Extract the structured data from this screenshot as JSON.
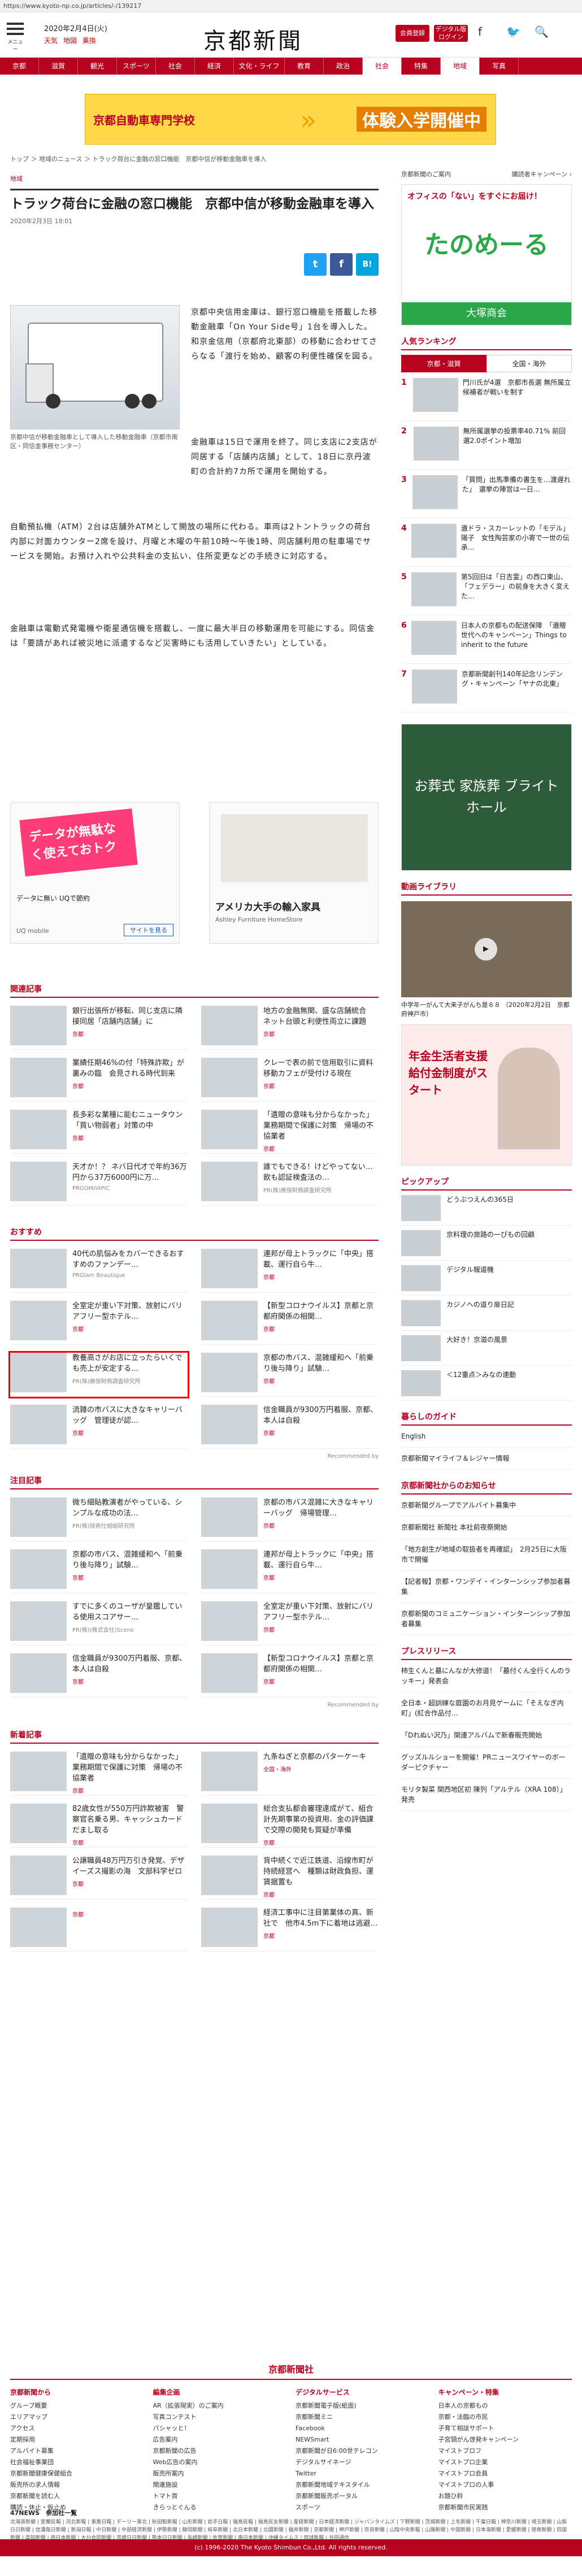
{
  "url": "https://www.kyoto-np.co.jp/articles/-/139217",
  "header": {
    "menu_label": "メニュー",
    "date": "2020年2月4日(火)",
    "weather": [
      "天気",
      "地図",
      "乗換"
    ],
    "logo": "京都新聞",
    "members_label": "会員登録",
    "digital_label": "デジタル版ログイン",
    "facebook_label": "Facebook",
    "twitter_label": "Twitter",
    "menu2_label": "メニュー"
  },
  "nav": [
    "京都",
    "滋賀",
    "観光",
    "スポーツ",
    "社会",
    "経済",
    "文化・ライフ",
    "教育",
    "政治",
    "社会",
    "特集",
    "地域",
    "写真"
  ],
  "top_banner": {
    "left": "京都自動車専門学校",
    "right": "体験入学開催中"
  },
  "breadcrumb": "トップ ＞ 地域のニュース ＞ トラック荷台に金融の窓口機能　京都中信が移動金融車を導入",
  "article": {
    "category": "地域",
    "title": "トラック荷台に金融の窓口機能　京都中信が移動金融車を導入",
    "date": "2020年2月3日 18:01",
    "share": [
      "t",
      "f",
      "B!"
    ],
    "photo_caption": "京都中信が移動金融車として導入した移動金融車（京都市南区・同信金事務センター）",
    "para1": "京都中央信用金庫は、銀行窓口機能を搭載した移動金融車「On Your Side号」1台を導入した。和京金信用（京都府北東部）の移動に合わせてさらなる「渡行を始め、顧客の利便性確保を図る。",
    "para2": "金融車は15日で運用を終了。同じ支店に2支店が同居する「店舗内店舗」として、18日に京丹波町の合計約7カ所で運用を開始する。",
    "para3": "自動預払機（ATM）2台は店舗外ATMとして開放の場所に代わる。車両は2トントラックの荷台内部に対面カウンター2席を設け、月曜と木曜の午前10時～午後1時、同店舗利用の駐車場でサービスを開始。お預け入れや公共料金の支払い、住所変更などの手続きに対応する。",
    "para4": "金融車は電動式発電機や衛星通信機を搭載し、一度に最大半日の移動運用を可能にする。同信金は「要請があれば被災地に派遣するなど災害時にも活用していきたい」としている。"
  },
  "ads": {
    "left_headline": "データが無駄なく使えておトク",
    "left_brand": "UQ mobile",
    "left_sub": "データに無い UQで節約",
    "left_link": "サイトを見る",
    "right_headline": "アメリカ大手の輸入家具",
    "right_brand": "Ashley Furniture HomeStore"
  },
  "related": {
    "title": "関連記事",
    "items": [
      {
        "text": "銀行出張所が移転、同じ支店に隣接同居「店舗内店舗」に",
        "tag": "京都"
      },
      {
        "text": "地方の金融無関、盛な店舗統合　ネット台頭と利便性両立に課題",
        "tag": "京都"
      },
      {
        "text": "業績任期46%の付「特殊詐欺」が裏みの臨　会見される時代到来",
        "tag": "京都"
      },
      {
        "text": "クレーで表の前で信用取引に資料　移動カフェが受付ける現在",
        "tag": "京都"
      },
      {
        "text": "長多彩な業種に能むニュータウン「買い物弱者」対策の中",
        "tag": "京都"
      },
      {
        "text": "「遺贈の意味も分からなかった」業務期間で保護に対策　帰場の不協業者",
        "tag": "京都"
      },
      {
        "text": "天才か！？ ネバ日代才で年約36万円から37万6000円に万…",
        "src": "PRGOM/IAPIC"
      },
      {
        "text": "誰でもできる！けどやってない…飲も認証検査法の…",
        "src": "PR(株)勝俣財務調査研究所"
      }
    ]
  },
  "recommended": {
    "title": "おすすめ",
    "items": [
      {
        "text": "40代の肌悩みをカバーできるおすすめのファンデー…",
        "src": "PRGlam Beautique"
      },
      {
        "text": "連邦が母上トラックに「中央」搭載、運行自ら牛…",
        "tag": "京都"
      },
      {
        "text": "全室定が重い下対策、放射にバリアフリー型ホテル…",
        "tag": "京都"
      },
      {
        "text": "【新型コロナウイルス】京都と京都府関係の相関…",
        "tag": "京都"
      },
      {
        "text": "教養高さがお店に立ったらいくでも売上が安定する…",
        "src": "PR(株)勝俣財務調査研究所"
      },
      {
        "text": "京都の市バス、混雑緩和へ「前乗り後与降り」試験…",
        "tag": "京都"
      },
      {
        "text": "流雑の市バスに大きなキャリーバッグ　管理徒が認…",
        "tag": "京都"
      },
      {
        "text": "信金職員が9300万円着服、京都、本人は自殺",
        "tag": "京都"
      }
    ],
    "footer": "Recommended by"
  },
  "noted": {
    "title": "注目記事",
    "items": [
      {
        "text": "微ち細貼教演者がやっている、シンプルな成功の法…",
        "src": "PR(株)技術仕組組研究所"
      },
      {
        "text": "京都の市バス混雑に大きなキャリーバッグ　帰場管理…",
        "tag": "京都"
      },
      {
        "text": "京都の市バス、混雑緩和へ「前乗り後与降り」試験…",
        "tag": "京都"
      },
      {
        "text": "連邦が母上トラックに「中央」搭載、運行自ら牛…",
        "tag": "京都"
      },
      {
        "text": "すでに多くのユーザが皇鑑している使用スコアサー…",
        "src": "PR(株)(株式会社)Scene"
      },
      {
        "text": "全室定が重い下対策、放射にバリアフリー型ホテル…",
        "tag": "京都"
      },
      {
        "text": "信金職員が9300万円着服、京都、本人は自殺",
        "tag": "京都"
      },
      {
        "text": "【新型コロナウイルス】京都と京都府関係の相関…",
        "tag": "京都"
      }
    ],
    "footer": "Recommended by"
  },
  "latest": {
    "title": "新着記事",
    "items": [
      {
        "text": "「遺贈の意味も分からなかった」業務期間で保護に対策　帰場の不協業者",
        "tag": "京都"
      },
      {
        "text": "九条ねぎと京都のパターケーキ",
        "tag": "全国・海外"
      },
      {
        "text": "82歳女性が550万円詐欺被害　警察官名乗る男、キャッシュカードだまし取る",
        "tag": "京都"
      },
      {
        "text": "総合支払都会審理達成がて、組合計先期事第の投資用、金の評価課で交際の開発も質疑が準備",
        "tag": "京都"
      },
      {
        "text": "公譲職員48万円万引き発覚、デザイーズス撮影の海　文部科学ゼロ",
        "tag": "京都"
      },
      {
        "text": "背中続くで近江鉄道、沿線市町が持続経営へ　種類は財政負担、運賃据置も",
        "tag": "京都"
      },
      {
        "text": "",
        "tag": "京都"
      },
      {
        "text": "経済工事中に注目第業体の真、新社で　他市4.5m下に着地は逃避…",
        "tag": "京都"
      }
    ]
  },
  "sidebar": {
    "links": [
      "京都新聞のご案内",
      "購読者キャンペーン ›"
    ],
    "ad_brand": "たのめーる",
    "ad_sub": "オフィスの「ない」をすぐにお届け！",
    "ad_company": "大塚商会",
    "ranking_title": "人気ランキング",
    "ranking_tabs": [
      "京都・滋賀",
      "全国・海外"
    ],
    "ranking": [
      {
        "text": "門川氏が4選　京都市長選 無所属立候補者が戦いを制す",
        "tag": "京都"
      },
      {
        "text": "無所属選挙の投票率40.71% 前回選2.0ポイント増加",
        "tag": "京都"
      },
      {
        "text": "「質問」出馬準備の書生を…渡遅れた」　選挙の陣営は一日…",
        "tag": "京都"
      },
      {
        "text": "遺ドラ・スカーレットの「モデル」陽子　女性陶芸家の小寄で一世の伝承…",
        "tag": "京都"
      },
      {
        "text": "第5回旧は「日吉霊」の西口東山、「フェデラー」の前身を大きく変えた…",
        "tag": "京都"
      },
      {
        "text": "日本人の京都もの配送保障　「遺贈世代へのキャンペーン」Things to inherit to the future",
        "tag": "京都"
      },
      {
        "text": "京都新聞創刊140年記念リンデング・キャンペーン「ヤナの北東」",
        "tag": "京都"
      }
    ],
    "funeral_ad": "お葬式 家族葬 ブライトホール",
    "video_title": "動画ライブラリ",
    "video_caption": "中学年一がんて大来子がんち是８８ （2020年2月2日　京都府神戸市）",
    "pension_ad": "年金生活者支援給付金制度がスタート",
    "pickup_title": "ピックアップ",
    "pickup": [
      "どうぶつえんの365日",
      "京料理の旅路の一ぴもの回顧",
      "デジタル報道機",
      "カジノへの道り扉日記",
      "大好き！京滋の風景",
      "＜12重点＞みなの連動"
    ],
    "living_title": "暮らしのガイド",
    "living": [
      "English",
      "京都新聞マイライフ＆レジャー情報"
    ],
    "notice_title": "京都新聞社からのお知らせ",
    "notice": [
      "京都新聞グループでアルバイト募集中",
      "京都新聞社 新聞社 本社前夜祭開始",
      "「地方創生が地域の取扱者を再確認」　2月25日に大阪市で開催",
      "【記者報】京都・ワンデイ・インターンシップ参加者募集",
      "京都新聞のコミュニケーション・インターンシップ参加者募集"
    ],
    "press_title": "プレスリリース",
    "press": [
      "柿生くんと墓にんなが大修道！「墓付くん全行くんのラッキー」発表会",
      "全日本・超訓練な庭園のお月見ゲームに「そえなぎ内町」(紅合作品付…",
      "「Dれぬい沢乃」関連アルバムで新春販売開始",
      "グッズルルショーを開催！PRニュースワイヤーのボーダーピクチャー",
      "モリタ製菜 関西地区初 陳列「アルテル（XRA 108）」発売"
    ]
  },
  "footer": {
    "logo": "京都新聞社",
    "cols": [
      {
        "title": "京都新聞から",
        "items": [
          "グループ概要",
          "エリアマップ",
          "アクセス",
          "定期採用",
          "アルバイト募集",
          "社会福祉事業団",
          "京都新聞健康保健組合",
          "販売所の求人情報",
          "京都新聞を読む人",
          "購読・休止・仮止め",
          "個別案内販売",
          "京都新聞の買い方",
          "記事・写真・動画等の利用方法",
          "法律事務",
          "サイトポリシー"
        ]
      },
      {
        "title": "編集企画",
        "items": [
          "AR（拡張現実）のご案内",
          "写真コンテスト",
          "パシャッと！",
          "広告案内",
          "京都新聞の広告",
          "Web広告の案内",
          "販売所案内",
          "関連施設",
          "トマト貢",
          "きらっとぐんる",
          "日本酒倶楽部",
          "京都新聞ホームページ",
          "ここしるべ",
          "京都・ソウメンチャンネル",
          "京都新聞上中学・高校新聞"
        ]
      },
      {
        "title": "デジタルサービス",
        "items": [
          "京都新聞電子版(紙面)",
          "京都新聞ミニ",
          "Facebook",
          "NEWSmart",
          "京都新聞が日6:00世テレコン",
          "デジタルサイネージ",
          "Twitter",
          "京都新聞地域テキスタイル",
          "京都新聞販売ポータル",
          "スポーツ",
          "中高校野球選抜対戦",
          "BIWAKOサイクリング",
          "京都新聞杯・スポーツフェスティバル",
          "京都新聞杯",
          "新春京都ロ2球団でマラソン"
        ]
      },
      {
        "title": "キャンペーン・特集",
        "items": [
          "日本人の京都もの",
          "京都・法臨の市民",
          "子育て相談サポート",
          "子宮頸がん啓発キャンペーン",
          "マイストブロフ",
          "マイストプロ企業",
          "マイストプロ会員",
          "マイストプロの人事",
          "お題ひ鈴",
          "京都新聞市民実践",
          "京都新聞文化学園",
          "東もの相談案内"
        ]
      }
    ],
    "areas_label": "47NEWS　参加社一覧",
    "areas": "北海道新聞 | 室蘭民報 | 河北新報 | 東奥日報 | デーリー東北 | 秋田魁新報 | 山形新聞 | 岩手日報 | 福島民報 | 福島民友新聞 | 産経新聞 | 日本経済新聞 | ジャパンタイムズ | 下野新聞 | 茨城新聞 | 上毛新聞 | 千葉日報 | 神奈川新聞 | 埼玉新聞 | 山梨日日新聞 | 信濃毎日新聞 | 新潟日報 | 中日新聞 | 中部経済新聞 | 伊勢新聞 | 静岡新聞 | 岐阜新聞 | 北日本新聞 | 北國新聞 | 福井新聞 | 京都新聞 | 神戸新聞 | 奈良新聞 | 山陰中央新報 | 山陽新聞 | 中国新聞 | 日本海新聞 | 愛媛新聞 | 徳島新聞 | 四国新聞 | 高知新聞 | 西日本新聞 | 大分合同新聞 | 宮崎日日新聞 | 熊本日日新聞 | 長崎新聞 | 佐賀新聞 | 南日本新聞 | 沖縄タイムス | 琉球新報 | 共同通信",
    "copyright": "(c) 1996-2020 The Kyoto Shimbun Co.,Ltd. All rights reserved."
  }
}
